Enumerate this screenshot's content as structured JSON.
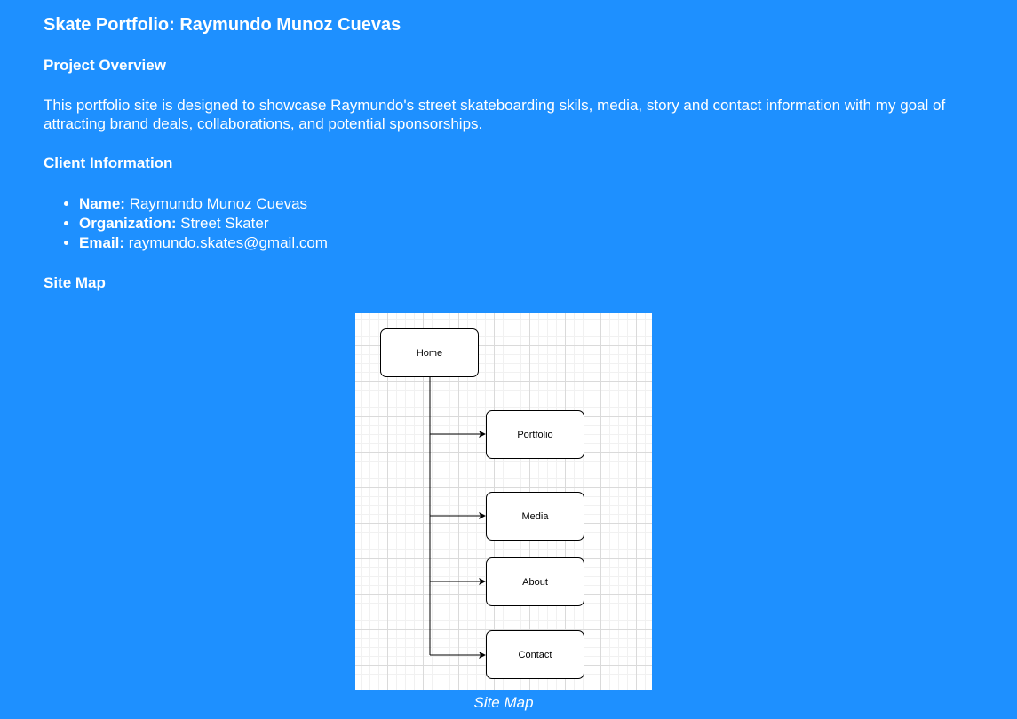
{
  "page": {
    "title": "Skate Portfolio: Raymundo Munoz Cuevas",
    "background_color": "#1e90ff",
    "text_color": "#ffffff"
  },
  "overview": {
    "heading": "Project Overview",
    "text": "This portfolio site is designed to showcase Raymundo's street skateboarding skils, media, story and contact information with my goal of attracting brand deals, collaborations, and potential sponsorships."
  },
  "client": {
    "heading": "Client Information",
    "items": [
      {
        "label": "Name:",
        "value": "Raymundo Munoz Cuevas"
      },
      {
        "label": "Organization:",
        "value": "Street Skater"
      },
      {
        "label": "Email:",
        "value": "raymundo.skates@gmail.com"
      }
    ]
  },
  "sitemap": {
    "heading": "Site Map",
    "caption": "Site Map",
    "nodes": {
      "root": "Home",
      "children": [
        "Portfolio",
        "Media",
        "About",
        "Contact"
      ]
    }
  }
}
